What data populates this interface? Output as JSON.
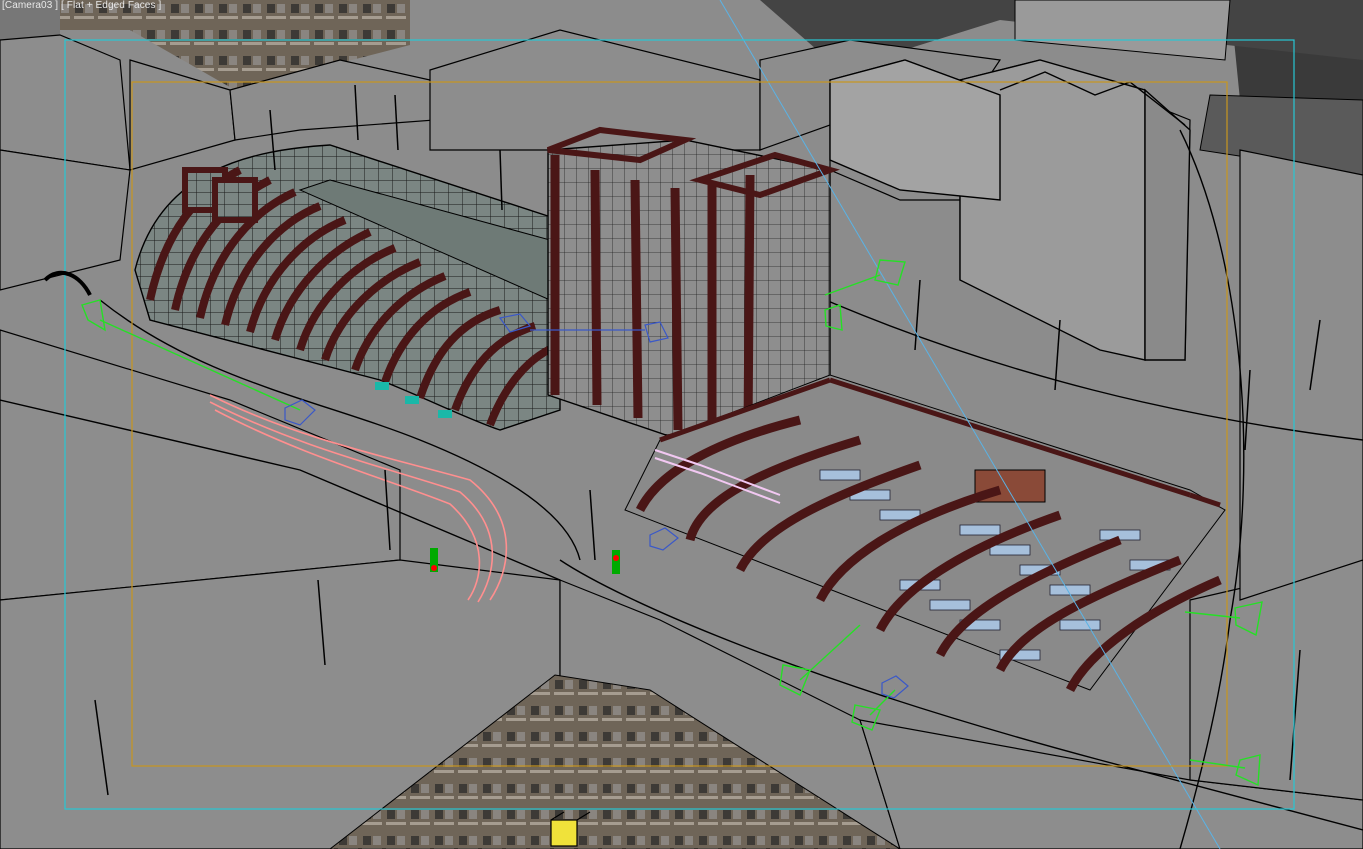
{
  "viewport": {
    "label_camera": "[Camera03 ]",
    "label_mode": "[ Flat + Edged Faces ]"
  },
  "colors": {
    "ground": "#8c8c8c",
    "edge": "#000000",
    "structure": "#4a1616",
    "glass": "#7a8a86",
    "safe_frame_outer": "#27c7d4",
    "safe_frame_inner": "#c8961e",
    "camera_green": "#25e025",
    "target_blue": "#3a58c8",
    "bench_blue": "#9fb9d6",
    "track_pink": "#ff8a8a"
  },
  "icons": [
    "camera-icon",
    "target-icon",
    "light-icon"
  ]
}
